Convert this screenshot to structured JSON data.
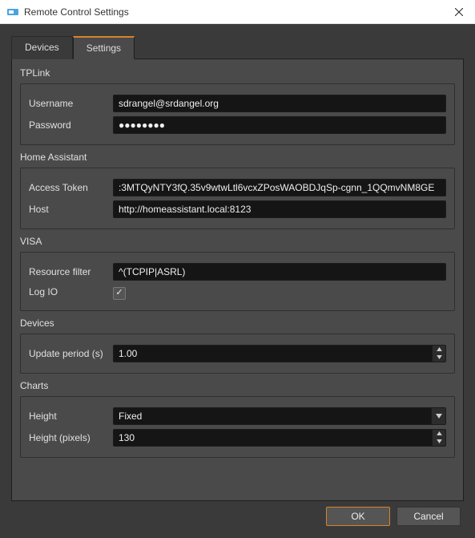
{
  "window": {
    "title": "Remote Control Settings"
  },
  "tabs": {
    "devices": "Devices",
    "settings": "Settings",
    "active": "settings"
  },
  "sections": {
    "tplink": {
      "title": "TPLink",
      "username_label": "Username",
      "username_value": "sdrangel@srdangel.org",
      "password_label": "Password",
      "password_value": "●●●●●●●●"
    },
    "ha": {
      "title": "Home Assistant",
      "token_label": "Access Token",
      "token_value": ":3MTQyNTY3fQ.35v9wtwLtl6vcxZPosWAOBDJqSp-cgnn_1QQmvNM8GE",
      "host_label": "Host",
      "host_value": "http://homeassistant.local:8123"
    },
    "visa": {
      "title": "VISA",
      "filter_label": "Resource filter",
      "filter_value": "^(TCPIP|ASRL)",
      "logio_label": "Log IO",
      "logio_checked": true
    },
    "devices": {
      "title": "Devices",
      "period_label": "Update period (s)",
      "period_value": "1.00"
    },
    "charts": {
      "title": "Charts",
      "height_label": "Height",
      "height_value": "Fixed",
      "heightpx_label": "Height (pixels)",
      "heightpx_value": "130"
    }
  },
  "buttons": {
    "ok": "OK",
    "cancel": "Cancel"
  }
}
